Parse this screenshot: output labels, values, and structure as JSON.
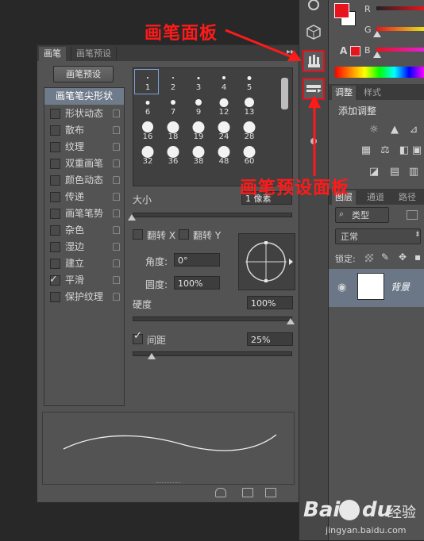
{
  "brush_panel": {
    "tabs": [
      "画笔",
      "画笔预设"
    ],
    "collapse_glyph": "▸▸",
    "preset_button": "画笔预设",
    "tip_shape_item": "画笔笔尖形状",
    "options": [
      {
        "label": "形状动态",
        "checked": false
      },
      {
        "label": "散布",
        "checked": false
      },
      {
        "label": "纹理",
        "checked": false
      },
      {
        "label": "双重画笔",
        "checked": false
      },
      {
        "label": "颜色动态",
        "checked": false
      },
      {
        "label": "传递",
        "checked": false
      },
      {
        "label": "画笔笔势",
        "checked": false
      },
      {
        "label": "杂色",
        "checked": false
      },
      {
        "label": "湿边",
        "checked": false
      },
      {
        "label": "建立",
        "checked": false
      },
      {
        "label": "平滑",
        "checked": true
      },
      {
        "label": "保护纹理",
        "checked": false
      }
    ],
    "brush_grid": [
      "1",
      "2",
      "3",
      "4",
      "5",
      "6",
      "7",
      "9",
      "12",
      "13",
      "16",
      "18",
      "19",
      "24",
      "28",
      "32",
      "36",
      "38",
      "48",
      "60"
    ],
    "size_label": "大小",
    "size_value": "1 像素",
    "flip_x_label": "翻转 X",
    "flip_y_label": "翻转 Y",
    "angle_label": "角度:",
    "angle_value": "0°",
    "roundness_label": "圆度:",
    "roundness_value": "100%",
    "hardness_label": "硬度",
    "hardness_value": "100%",
    "spacing_label": "间距",
    "spacing_value": "25%",
    "spacing_checked": true
  },
  "color_panel": {
    "r_label": "R",
    "g_label": "G",
    "b_label": "B",
    "warning_glyph": "A",
    "foreground_color": "#e8131c",
    "background_color": "#ffffff"
  },
  "adjustments_panel": {
    "tabs": [
      "调整",
      "样式"
    ],
    "title": "添加调整"
  },
  "layers_panel": {
    "tabs": [
      "图层",
      "通道",
      "路径"
    ],
    "filter_kind": "类型",
    "blend_mode": "正常",
    "lock_label": "锁定:",
    "layer_name": "背景"
  },
  "annotations": {
    "brush_panel_label": "画笔面板",
    "brush_presets_panel_label": "画笔预设面板"
  },
  "watermark": {
    "brand_bai": "Bai",
    "brand_du": "du",
    "brand_suffix": "经验",
    "url": "jingyan.baidu.com"
  }
}
